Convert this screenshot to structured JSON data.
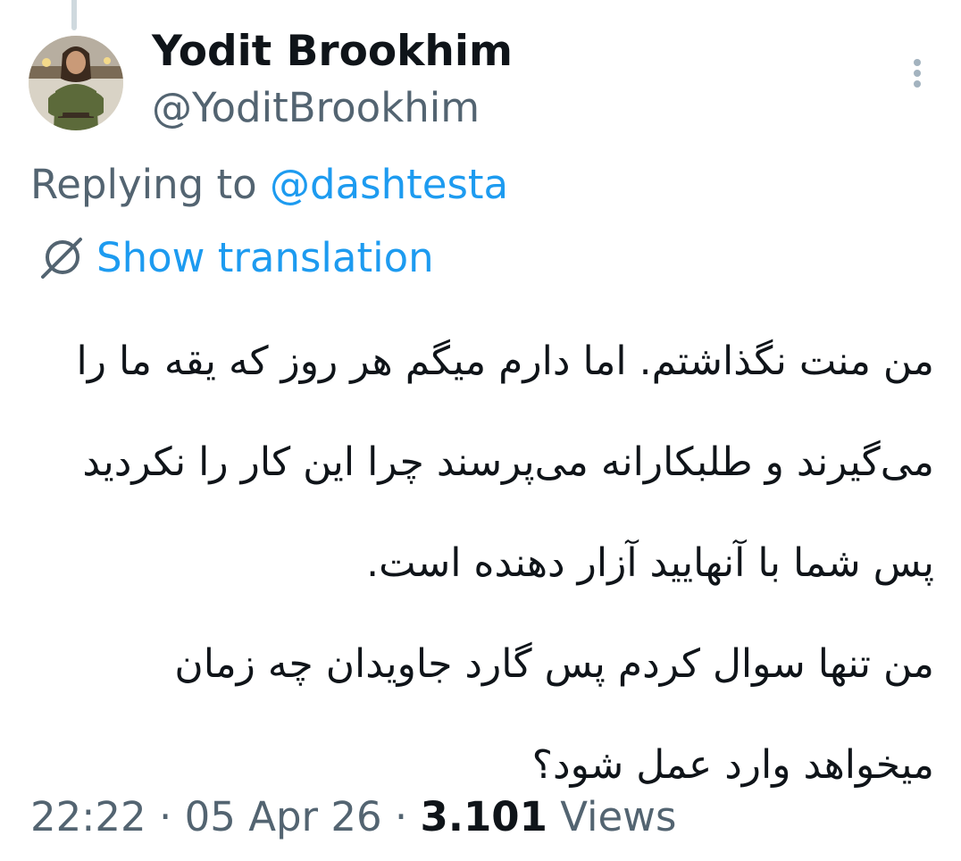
{
  "tweet": {
    "display_name": "Yodit Brookhim",
    "handle": "@YoditBrookhim",
    "replying_prefix": "Replying to ",
    "replying_handle": "@dashtesta",
    "show_translation": "Show translation",
    "body_paragraphs": [
      "من منت نگذاشتم. اما دارم میگم هر روز که یقه ما را می‌گیرند و طلبکارانه می‌پرسند چرا این کار را نکردید پس شما با آنهایید آزار دهنده است.",
      "من تنها سوال کردم پس گارد جاویدان چه زمان میخواهد وارد عمل شود؟"
    ],
    "time": "22:22",
    "separator": "·",
    "date": "05 Apr 26",
    "views_count": "3.101",
    "views_label": "Views"
  },
  "icons": {
    "more": "more-vertical-icon",
    "translate": "globe-slash-icon"
  },
  "colors": {
    "accent": "#1d9bf0",
    "secondary_text": "#536471",
    "primary_text": "#0f1419"
  }
}
